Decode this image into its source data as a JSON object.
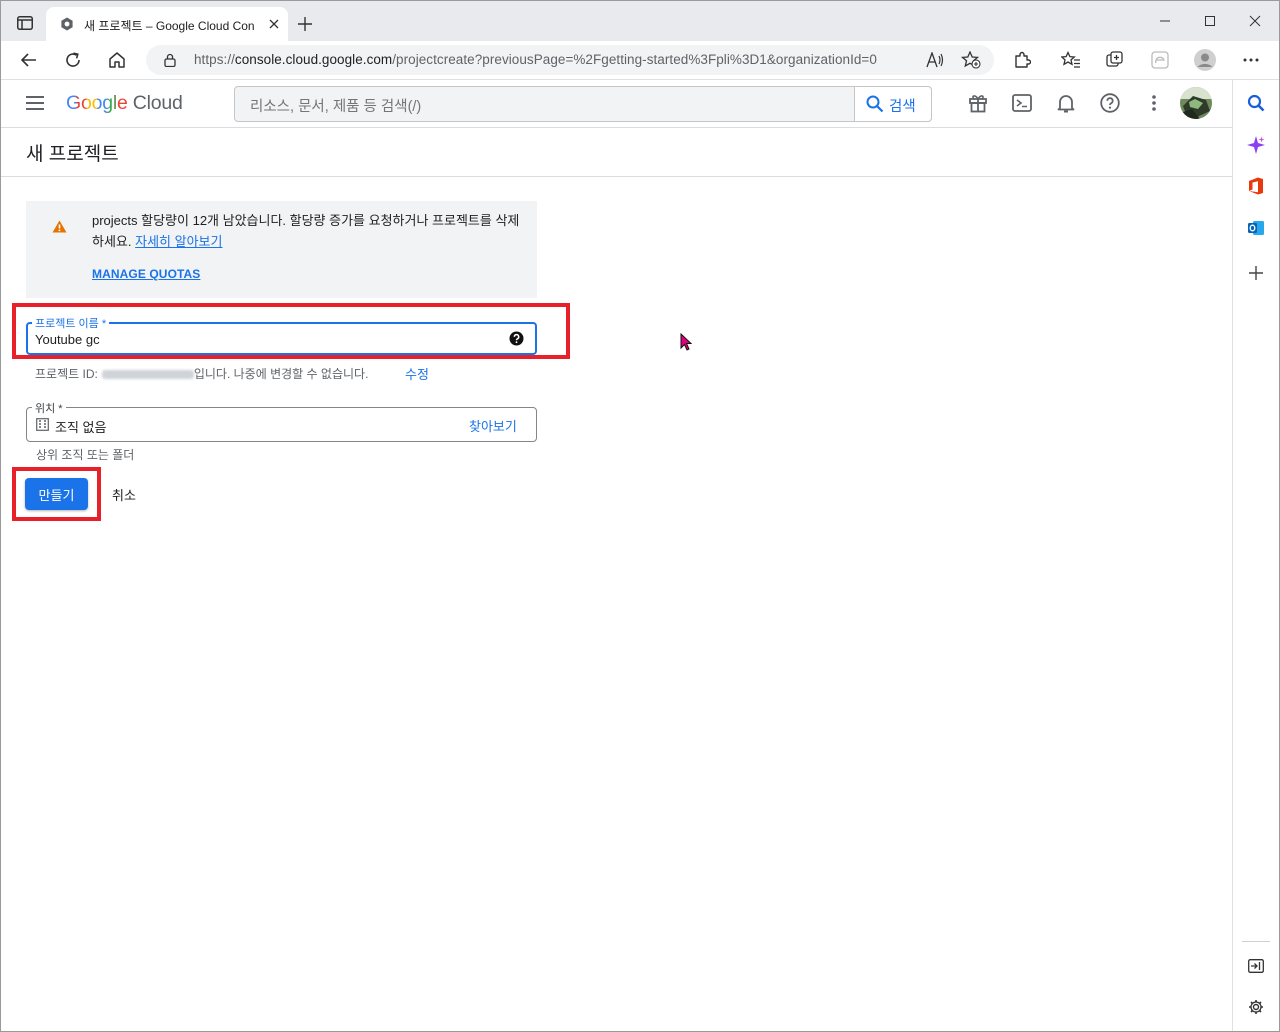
{
  "browser": {
    "tab_title": "새 프로젝트 – Google Cloud Con",
    "url_prefix": "https://",
    "url_host": "console.cloud.google.com",
    "url_path": "/projectcreate?previousPage=%2Fgetting-started%3Fpli%3D1&organizationId=0"
  },
  "header": {
    "logo_google": "Google",
    "logo_cloud": "Cloud",
    "search_placeholder": "리소스, 문서, 제품 등 검색(/)",
    "search_button": "검색"
  },
  "page": {
    "title": "새 프로젝트"
  },
  "warning": {
    "message": "projects 할당량이 12개 남았습니다. 할당량 증가를 요청하거나 프로젝트를 삭제하세요.",
    "learn_more": "자세히 알아보기",
    "manage_quotas": "MANAGE QUOTAS"
  },
  "form": {
    "project_name_label": "프로젝트 이름 *",
    "project_name_value": "Youtube gc",
    "project_id_prefix": "프로젝트 ID:",
    "project_id_suffix": "입니다. 나중에 변경할 수 없습니다.",
    "project_id_edit": "수정",
    "location_label": "위치 *",
    "location_value": "조직 없음",
    "browse": "찾아보기",
    "location_hint": "상위 조직 또는 폴더",
    "create_button": "만들기",
    "cancel_button": "취소"
  },
  "colors": {
    "accent": "#1a73e8",
    "highlight": "#e8202a",
    "warning": "#e37400"
  },
  "icons": [
    "sidebar-toggle-icon",
    "gcp-tab-icon",
    "new-tab-icon",
    "minimize-icon",
    "maximize-icon",
    "close-icon",
    "back-icon",
    "refresh-icon",
    "home-icon",
    "lock-icon",
    "read-aloud-icon",
    "add-favorite-icon",
    "extensions-icon",
    "favorites-icon",
    "collections-icon",
    "browser-essentials-icon",
    "profile-icon",
    "more-icon",
    "menu-icon",
    "search-icon",
    "gift-icon",
    "cloud-shell-icon",
    "notifications-icon",
    "help-icon",
    "more-vert-icon",
    "user-avatar",
    "warning-icon",
    "help-circle-icon",
    "building-icon",
    "edge-search-icon",
    "copilot-icon",
    "office-icon",
    "outlook-icon",
    "add-sidebar-icon",
    "hide-sidebar-icon",
    "settings-icon"
  ]
}
